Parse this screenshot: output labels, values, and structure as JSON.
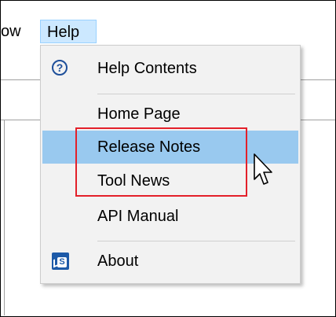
{
  "menubar": {
    "items": [
      {
        "label": "ow"
      },
      {
        "label": "Help"
      }
    ]
  },
  "help_menu": {
    "items": [
      {
        "label": "Help Contents",
        "icon": "help-circle-icon"
      },
      {
        "label": "Home Page"
      },
      {
        "label": "Release Notes",
        "highlighted": true
      },
      {
        "label": "Tool News"
      },
      {
        "label": "API Manual"
      },
      {
        "label": "About",
        "icon": "app-logo-icon"
      }
    ]
  },
  "icons": {
    "help_glyph": "?",
    "about_glyph": "S"
  },
  "colors": {
    "menu_background": "#f2f2f2",
    "highlight": "#99c9ef",
    "menubar_selected": "#cce8ff",
    "annotation": "#e3202a",
    "help_icon": "#1e4f9a",
    "about_icon": "#1d5aa8"
  }
}
